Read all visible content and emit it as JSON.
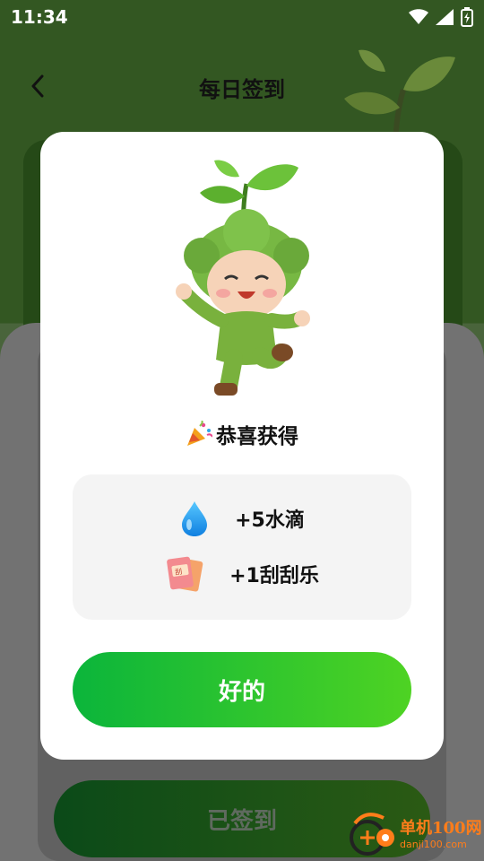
{
  "status_bar": {
    "time": "11:34",
    "icons": [
      "wifi-icon",
      "signal-icon",
      "battery-charging-icon"
    ]
  },
  "nav": {
    "back_icon": "chevron-left-icon",
    "title": "每日签到"
  },
  "background": {
    "signed_button_label": "已签到"
  },
  "dialog": {
    "mascot_icon": "sprout-mascot-icon",
    "congrats_icon": "party-popper-icon",
    "congrats_text": "恭喜获得",
    "rewards": [
      {
        "icon": "water-drop-icon",
        "text": "+5水滴"
      },
      {
        "icon": "scratch-card-icon",
        "text": "+1刮刮乐"
      }
    ],
    "ok_label": "好的"
  },
  "watermark": {
    "cn": "单机100网",
    "en": "danji100.com"
  },
  "colors": {
    "page_bg": "#4d6b31",
    "dialog_bg": "#ffffff",
    "reward_box_bg": "#f4f4f4",
    "ok_button_start": "#0bb53b",
    "ok_button_end": "#4ed323"
  }
}
